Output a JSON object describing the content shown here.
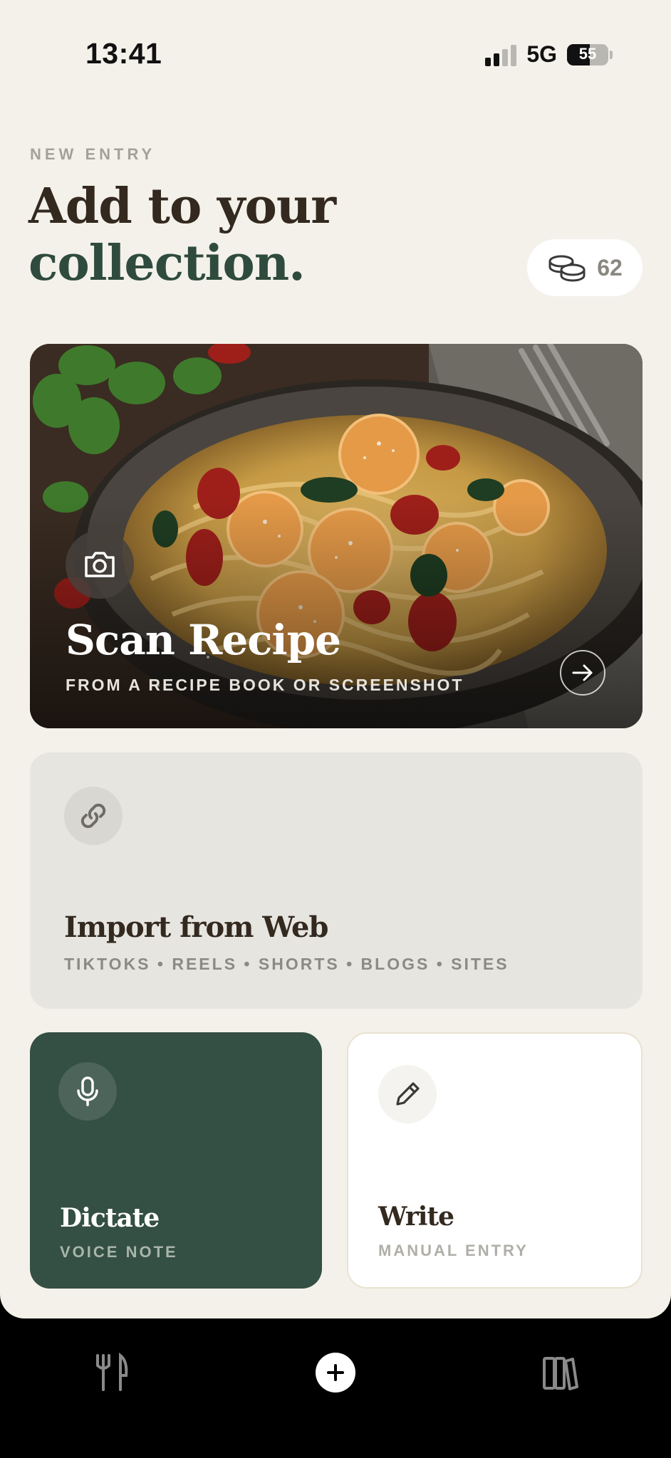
{
  "status_bar": {
    "time": "13:41",
    "network": "5G",
    "battery": "55"
  },
  "header": {
    "eyebrow": "NEW ENTRY",
    "title_line1": "Add to your",
    "title_line2": "collection.",
    "credits": "62"
  },
  "scan_card": {
    "title": "Scan Recipe",
    "subtitle": "FROM A RECIPE BOOK OR SCREENSHOT"
  },
  "import_card": {
    "title": "Import from Web",
    "subtitle": "TIKTOKS • REELS • SHORTS • BLOGS • SITES"
  },
  "dictate_card": {
    "title": "Dictate",
    "subtitle": "VOICE NOTE"
  },
  "write_card": {
    "title": "Write",
    "subtitle": "MANUAL ENTRY"
  },
  "tab_bar": {
    "items": [
      {
        "icon": "fork-knife-icon"
      },
      {
        "icon": "plus-icon",
        "active": true
      },
      {
        "icon": "books-icon"
      }
    ]
  },
  "colors": {
    "background": "#f3f1ea",
    "accent_green": "#2f4b3e",
    "title_brown": "#33291f",
    "dictate_card": "#344f43"
  }
}
